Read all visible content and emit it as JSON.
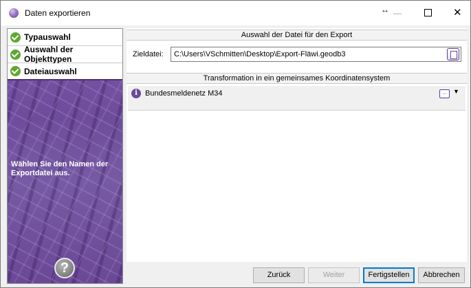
{
  "window": {
    "title": "Daten exportieren",
    "controls": {
      "resize": "↔",
      "minimize": "—",
      "maximize": "",
      "close": "✕"
    }
  },
  "sidebar": {
    "steps": [
      {
        "label": "Typauswahl",
        "done": true
      },
      {
        "label": "Auswahl der Objekttypen",
        "done": true
      },
      {
        "label": "Dateiauswahl",
        "done": true,
        "active": true
      }
    ],
    "hint": "Wählen Sie den Namen der Exportdatei aus.",
    "help_symbol": "?"
  },
  "file_section": {
    "header": "Auswahl der Datei für den Export",
    "target_label": "Zieldatei:",
    "target_value": "C:\\Users\\VSchmitten\\Desktop\\Export-Fläwi.geodb3"
  },
  "crs_section": {
    "header": "Transformation in ein gemeinsames Koordinatensystem",
    "info_symbol": "i",
    "value": "Bundesmeldenetz M34",
    "more_label": "...",
    "dropdown_symbol": "▼"
  },
  "buttons": {
    "back": "Zurück",
    "next": "Weiter",
    "finish": "Fertigstellen",
    "cancel": "Abbrechen"
  },
  "colors": {
    "accent": "#6a4a9c",
    "check": "#5fa82f",
    "focus": "#0078d7"
  }
}
